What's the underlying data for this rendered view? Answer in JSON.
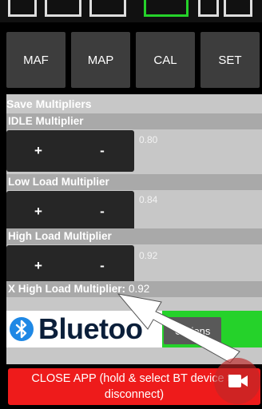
{
  "nav": {
    "tabs": [
      "MAF",
      "MAP",
      "CAL",
      "SET"
    ]
  },
  "panel": {
    "title": "Save Multipliers",
    "plus_label": "+",
    "minus_label": "-",
    "idle": {
      "label": "IDLE Multiplier",
      "value": "0.80"
    },
    "low": {
      "label": "Low Load Multiplier",
      "value": "0.84"
    },
    "high": {
      "label": "High Load Multiplier",
      "value": "0.92"
    },
    "xhigh": {
      "label": "X High Load Multiplier:",
      "value": "0.92"
    }
  },
  "bluetooth": {
    "text": "Bluetoo",
    "options_label": "Options"
  },
  "close_app": {
    "label": "CLOSE APP (hold & select BT device to disconnect)"
  },
  "colors": {
    "brand_green": "#25d22a",
    "close_red": "#ee1b1b",
    "bt_blue": "#1e88e5",
    "button_gray": "#3d3d3d"
  }
}
